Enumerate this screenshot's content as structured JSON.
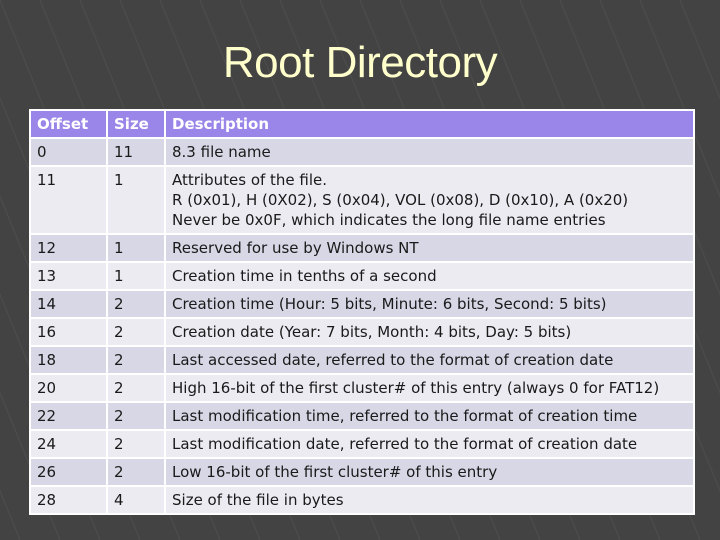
{
  "slide": {
    "title": "Root Directory"
  },
  "table": {
    "headers": [
      "Offset",
      "Size",
      "Description"
    ],
    "rows": [
      {
        "offset": "0",
        "size": "11",
        "desc": [
          "8.3 file name"
        ]
      },
      {
        "offset": "11",
        "size": "1",
        "desc": [
          "Attributes of the file.",
          "R (0x01), H (0X02), S (0x04), VOL (0x08), D (0x10), A (0x20)",
          "Never be 0x0F, which indicates the long file name entries"
        ]
      },
      {
        "offset": "12",
        "size": "1",
        "desc": [
          "Reserved for use by Windows NT"
        ]
      },
      {
        "offset": "13",
        "size": "1",
        "desc": [
          "Creation time in tenths of a second"
        ]
      },
      {
        "offset": "14",
        "size": "2",
        "desc": [
          "Creation time (Hour: 5 bits, Minute: 6 bits, Second: 5 bits)"
        ]
      },
      {
        "offset": "16",
        "size": "2",
        "desc": [
          "Creation date (Year: 7 bits, Month: 4 bits, Day: 5 bits)"
        ]
      },
      {
        "offset": "18",
        "size": "2",
        "desc": [
          "Last accessed date, referred to the format of creation date"
        ]
      },
      {
        "offset": "20",
        "size": "2",
        "desc": [
          "High 16-bit of the first cluster# of this entry (always 0 for FAT12)"
        ]
      },
      {
        "offset": "22",
        "size": "2",
        "desc": [
          "Last modification time, referred to the format of creation time"
        ]
      },
      {
        "offset": "24",
        "size": "2",
        "desc": [
          "Last modification date, referred to the format of creation date"
        ]
      },
      {
        "offset": "26",
        "size": "2",
        "desc": [
          "Low 16-bit of the first cluster# of this entry"
        ]
      },
      {
        "offset": "28",
        "size": "4",
        "desc": [
          "Size of the file in bytes"
        ]
      }
    ]
  },
  "colors": {
    "background": "#434343",
    "title": "#ffffcc",
    "header": "#9a86e8",
    "row_odd": "#d8d7e6",
    "row_even": "#ecebf2"
  }
}
